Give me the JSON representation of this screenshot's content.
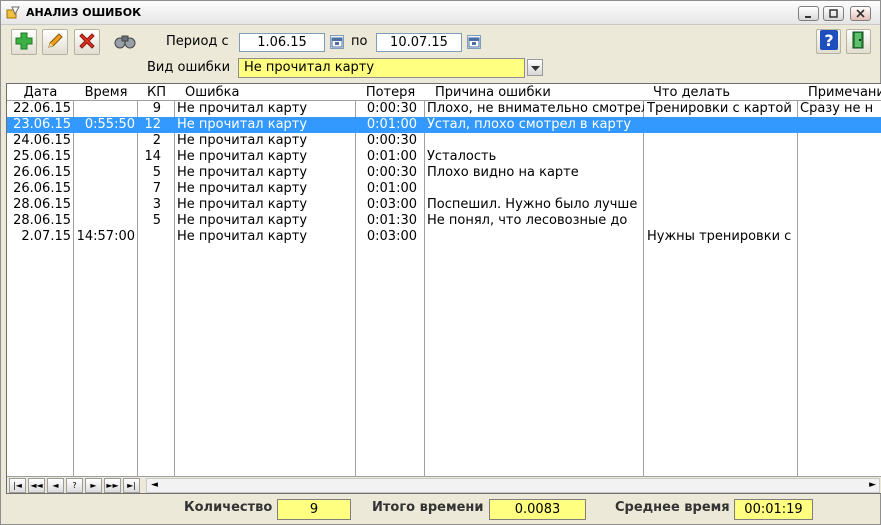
{
  "window": {
    "title": "АНАЛИЗ ОШИБОК"
  },
  "filters": {
    "period_label": "Период с",
    "date_from": "1.06.15",
    "to_label": "по",
    "date_to": "10.07.15",
    "error_type_label": "Вид ошибки",
    "error_type_value": "Не прочитал карту"
  },
  "toolbar": {
    "icons": [
      "add-icon",
      "edit-icon",
      "delete-icon",
      "binoculars-icon",
      "help-icon",
      "exit-icon"
    ]
  },
  "table": {
    "columns": [
      "Дата",
      "Время",
      "КП",
      "Ошибка",
      "Потеря",
      "Причина ошибки",
      "Что делать",
      "Примечание"
    ],
    "rows": [
      {
        "date": "22.06.15",
        "time": "",
        "kp": "9",
        "error": "Не прочитал карту",
        "loss": "0:00:30",
        "cause": "Плохо, не внимательно смотрел",
        "todo": "Тренировки с картой",
        "note": "Сразу не н"
      },
      {
        "date": "23.06.15",
        "time": "0:55:50",
        "kp": "12",
        "error": "Не прочитал карту",
        "loss": "0:01:00",
        "cause": "Устал, плохо смотрел в карту",
        "todo": "",
        "note": ""
      },
      {
        "date": "24.06.15",
        "time": "",
        "kp": "2",
        "error": "Не прочитал карту",
        "loss": "0:00:30",
        "cause": "",
        "todo": "",
        "note": ""
      },
      {
        "date": "25.06.15",
        "time": "",
        "kp": "14",
        "error": "Не прочитал карту",
        "loss": "0:01:00",
        "cause": "Усталость",
        "todo": "",
        "note": ""
      },
      {
        "date": "26.06.15",
        "time": "",
        "kp": "5",
        "error": "Не прочитал карту",
        "loss": "0:00:30",
        "cause": "Плохо видно на карте",
        "todo": "",
        "note": ""
      },
      {
        "date": "26.06.15",
        "time": "",
        "kp": "7",
        "error": "Не прочитал карту",
        "loss": "0:01:00",
        "cause": "",
        "todo": "",
        "note": ""
      },
      {
        "date": "28.06.15",
        "time": "",
        "kp": "3",
        "error": "Не прочитал карту",
        "loss": "0:03:00",
        "cause": "Поспешил. Нужно было лучше",
        "todo": "",
        "note": ""
      },
      {
        "date": "28.06.15",
        "time": "",
        "kp": "5",
        "error": "Не прочитал карту",
        "loss": "0:01:30",
        "cause": "Не понял, что лесовозные до",
        "todo": "",
        "note": ""
      },
      {
        "date": "2.07.15",
        "time": "14:57:00",
        "kp": "",
        "error": "Не прочитал карту",
        "loss": "0:03:00",
        "cause": "",
        "todo": "Нужны тренировки с",
        "note": ""
      }
    ],
    "selected_row": 1
  },
  "navigator": {
    "buttons": [
      "|◄",
      "◄◄",
      "◄",
      "?",
      "►",
      "►►",
      "►|"
    ]
  },
  "footer": {
    "count_label": "Количество",
    "count_value": "9",
    "total_label": "Итого времени",
    "total_value": "0.0083",
    "avg_label": "Среднее время",
    "avg_value": "00:01:19"
  },
  "colors": {
    "highlight": "#ffff80",
    "selection": "#3399ff"
  }
}
